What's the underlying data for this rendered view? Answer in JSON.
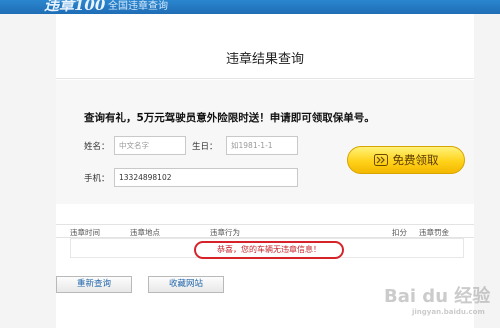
{
  "site": {
    "logo_text": "违章100",
    "slogan": "全国违章查询"
  },
  "page": {
    "title": "违章结果查询"
  },
  "promo": {
    "text": "查询有礼，5万元驾驶员意外险限时送！申请即可领取保单号。",
    "name_label": "姓名：",
    "name_placeholder": "中文名字",
    "birthday_label": "生日：",
    "birthday_placeholder": "如1981-1-1",
    "phone_label": "手机：",
    "phone_value": "13324898102",
    "claim_label": "免费领取",
    "claim_icon": "double-chevron-right-icon",
    "claim_color": "#ffd21a"
  },
  "table": {
    "headers": [
      "违章时间",
      "违章地点",
      "违章行为",
      "扣分",
      "违章罚金"
    ],
    "message": "恭喜，您的车辆无违章信息！",
    "highlight_color": "#d6232a"
  },
  "actions": {
    "requery_label": "重新查询",
    "favorite_label": "收藏网站"
  },
  "watermark": {
    "text": "Bai du 经验",
    "sub": "jingyan.baidu.com"
  }
}
